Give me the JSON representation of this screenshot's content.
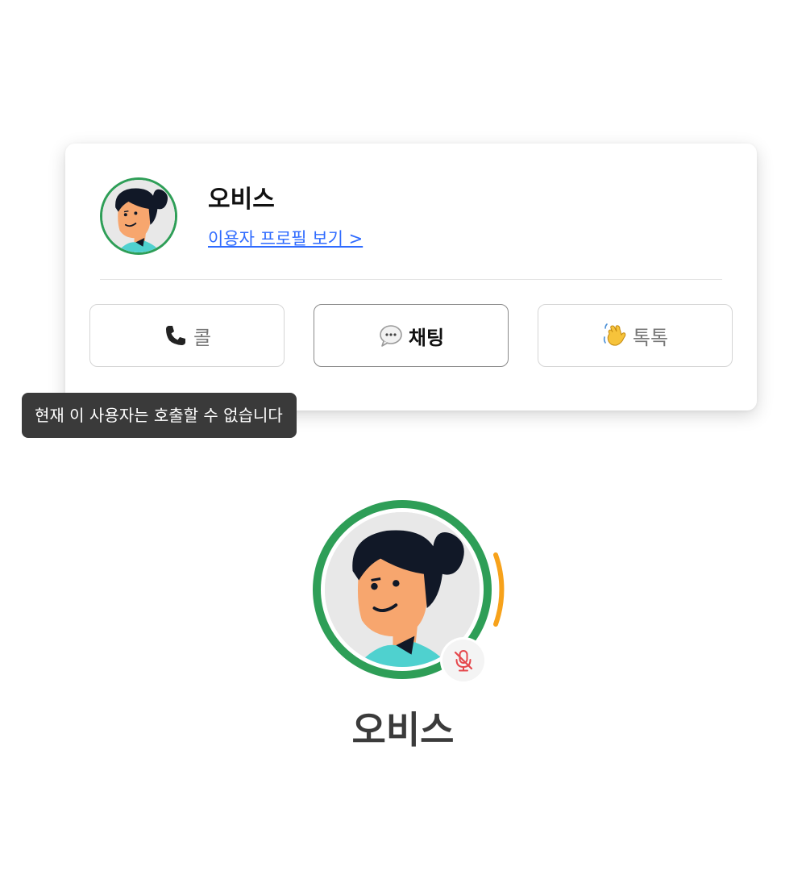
{
  "profile_card": {
    "name": "오비스",
    "profile_link": "이용자 프로필 보기 >",
    "avatar_icon": "person-avatar-icon",
    "avatar_ring_color": "#2e9e57",
    "link_color": "#2f6bff"
  },
  "actions": {
    "call": {
      "icon": "phone-icon",
      "label": "콜"
    },
    "chat": {
      "icon": "speech-bubble-icon",
      "label": "채팅"
    },
    "poke": {
      "icon": "waving-hand-icon",
      "label": "톡톡"
    }
  },
  "tooltip": {
    "text": "현재 이 사용자는 호출할 수 없습니다"
  },
  "participant": {
    "name": "오비스",
    "ring_color": "#2e9e57",
    "speaking_color": "#f7a21b",
    "mic_icon": "mic-muted-icon",
    "mic_color": "#e5484d"
  }
}
